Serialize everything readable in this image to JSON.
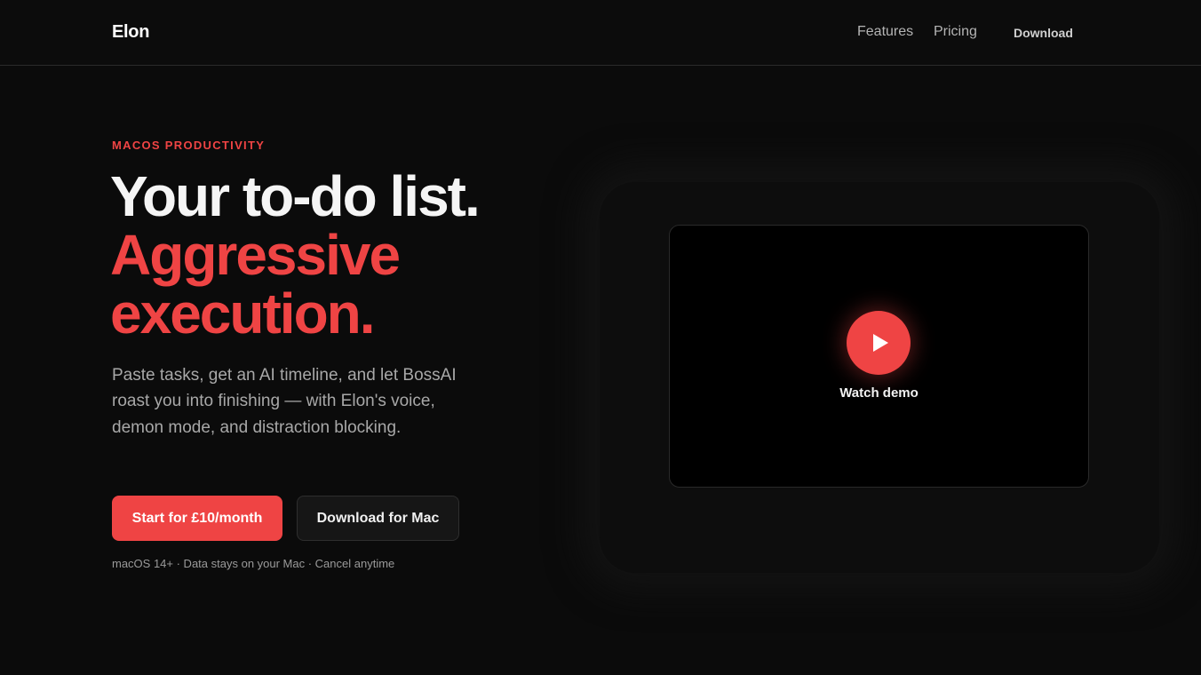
{
  "nav": {
    "brand": "Elon",
    "links": [
      "Features",
      "Pricing"
    ],
    "download": "Download"
  },
  "hero": {
    "eyebrow": "MACOS PRODUCTIVITY",
    "headline_line1": "Your to-do list.",
    "headline_line2": "Aggressive execution.",
    "description": "Paste tasks, get an AI timeline, and let BossAI roast you into finishing — with Elon's voice, demon mode, and distraction blocking.",
    "primary_cta": "Start for £10/month",
    "secondary_cta": "Download for Mac",
    "meta": "macOS 14+ · Data stays on your Mac · Cancel anytime"
  },
  "video": {
    "play_icon": "play-icon",
    "label": "Watch demo"
  },
  "colors": {
    "accent": "#ef4444",
    "background": "#0b0b0b"
  }
}
